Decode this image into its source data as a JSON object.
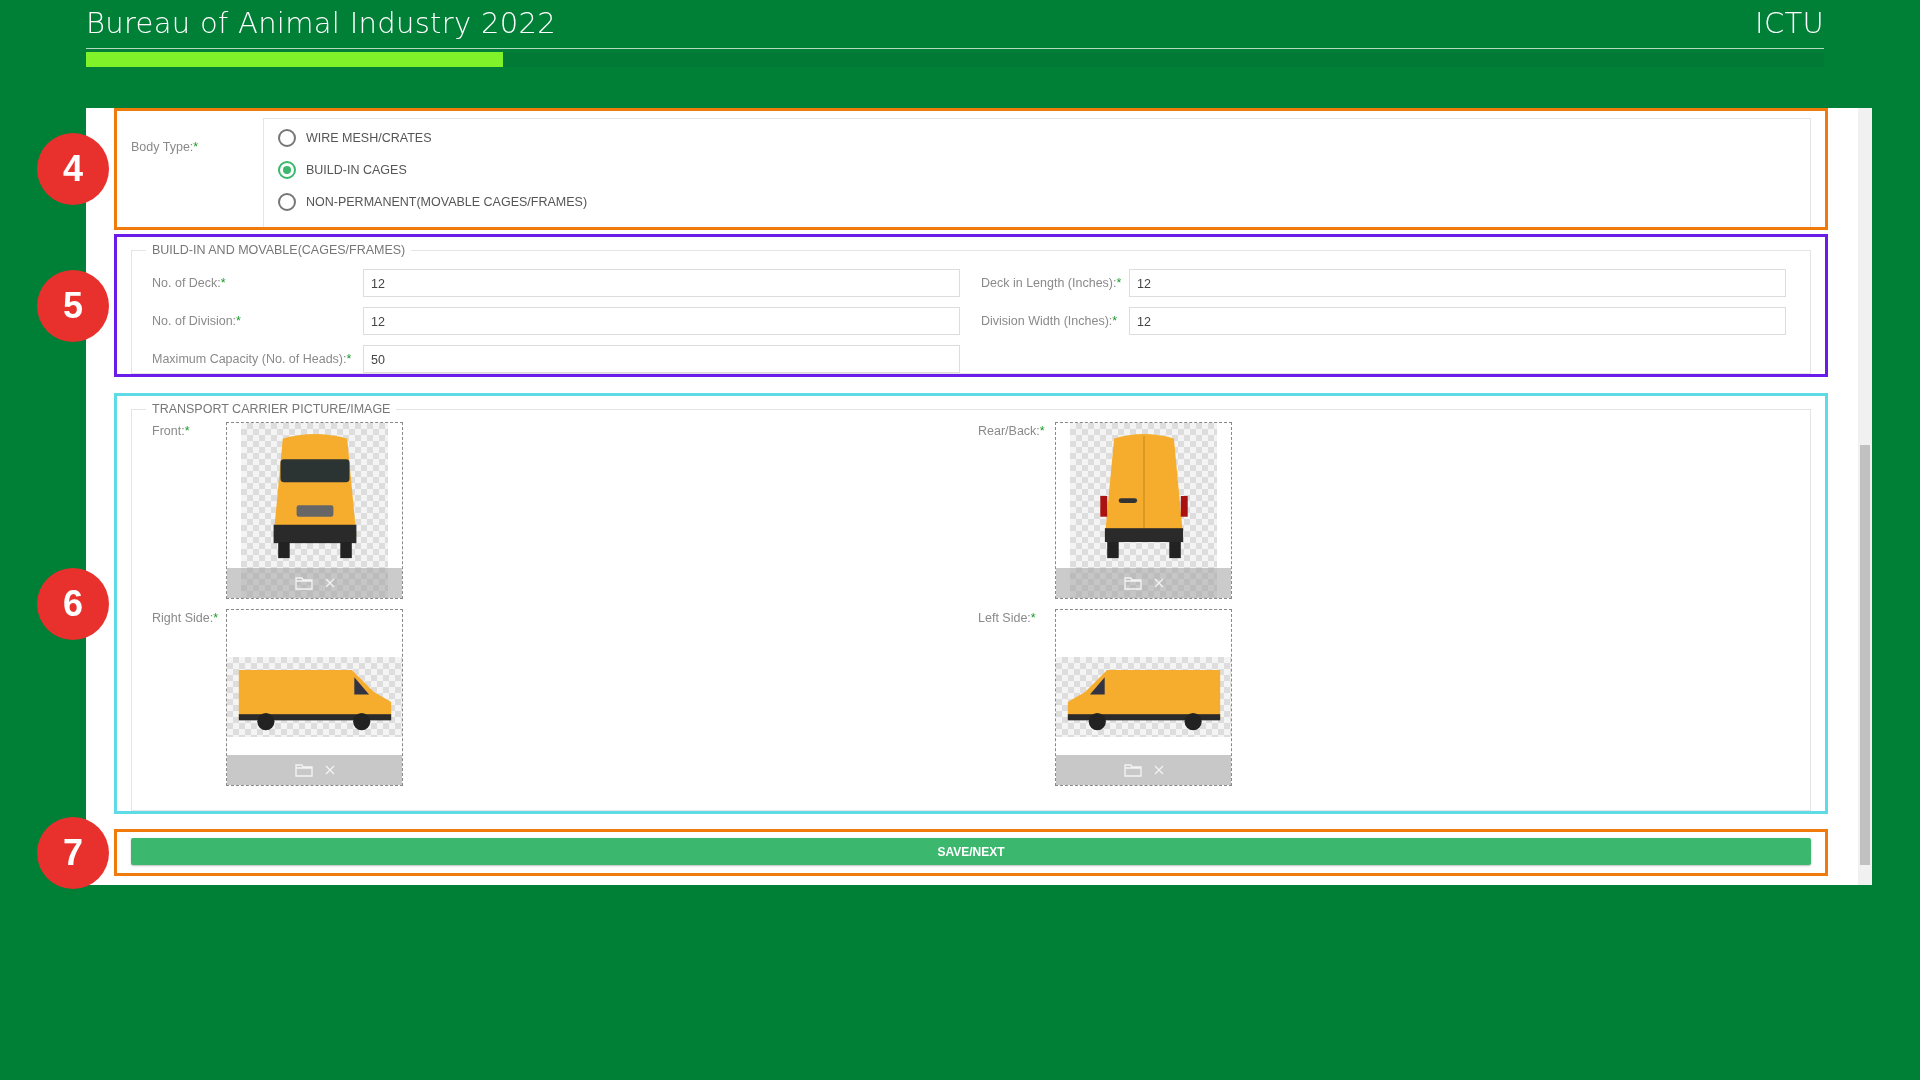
{
  "header": {
    "title": "Bureau of Animal Industry 2022",
    "brand": "ICTU",
    "progress": {
      "level": 0.24
    }
  },
  "sections": [
    {
      "kind": "radio",
      "callout": "4",
      "color": "#f07a0c",
      "label": "Body Type:",
      "required": "*",
      "options": [
        {
          "label": "WIRE MESH/CRATES",
          "selected": false
        },
        {
          "label": "BUILD-IN CAGES",
          "selected": true
        },
        {
          "label": "NON-PERMANENT(MOVABLE CAGES/FRAMES)",
          "selected": false
        }
      ]
    },
    {
      "kind": "fields",
      "callout": "5",
      "color": "#6a1ce8",
      "legend": "BUILD-IN AND MOVABLE(CAGES/FRAMES)",
      "rows": [
        [
          {
            "label": "No. of Deck:",
            "required": "*",
            "value": "12"
          },
          {
            "label": "Deck in Length (Inches):",
            "required": "*",
            "value": "12"
          }
        ],
        [
          {
            "label": "No. of Division:",
            "required": "*",
            "value": "12"
          },
          {
            "label": "Division Width (Inches):",
            "required": "*",
            "value": "12"
          }
        ],
        [
          {
            "label": "Maximum Capacity (No. of Heads):",
            "required": "*",
            "value": "50"
          }
        ]
      ]
    },
    {
      "kind": "images",
      "callout": "6",
      "color": "#5fdbe6",
      "legend": "TRANSPORT CARRIER PICTURE/IMAGE",
      "tiles": [
        {
          "label": "Front:",
          "required": "*",
          "kind": "front"
        },
        {
          "label": "Rear/Back:",
          "required": "*",
          "kind": "rear"
        },
        {
          "label": "Right Side:",
          "required": "*",
          "kind": "right"
        },
        {
          "label": "Left Side:",
          "required": "*",
          "kind": "left"
        }
      ]
    },
    {
      "kind": "button",
      "callout": "7",
      "color": "#f07a0c",
      "button": "SAVE/NEXT"
    }
  ]
}
